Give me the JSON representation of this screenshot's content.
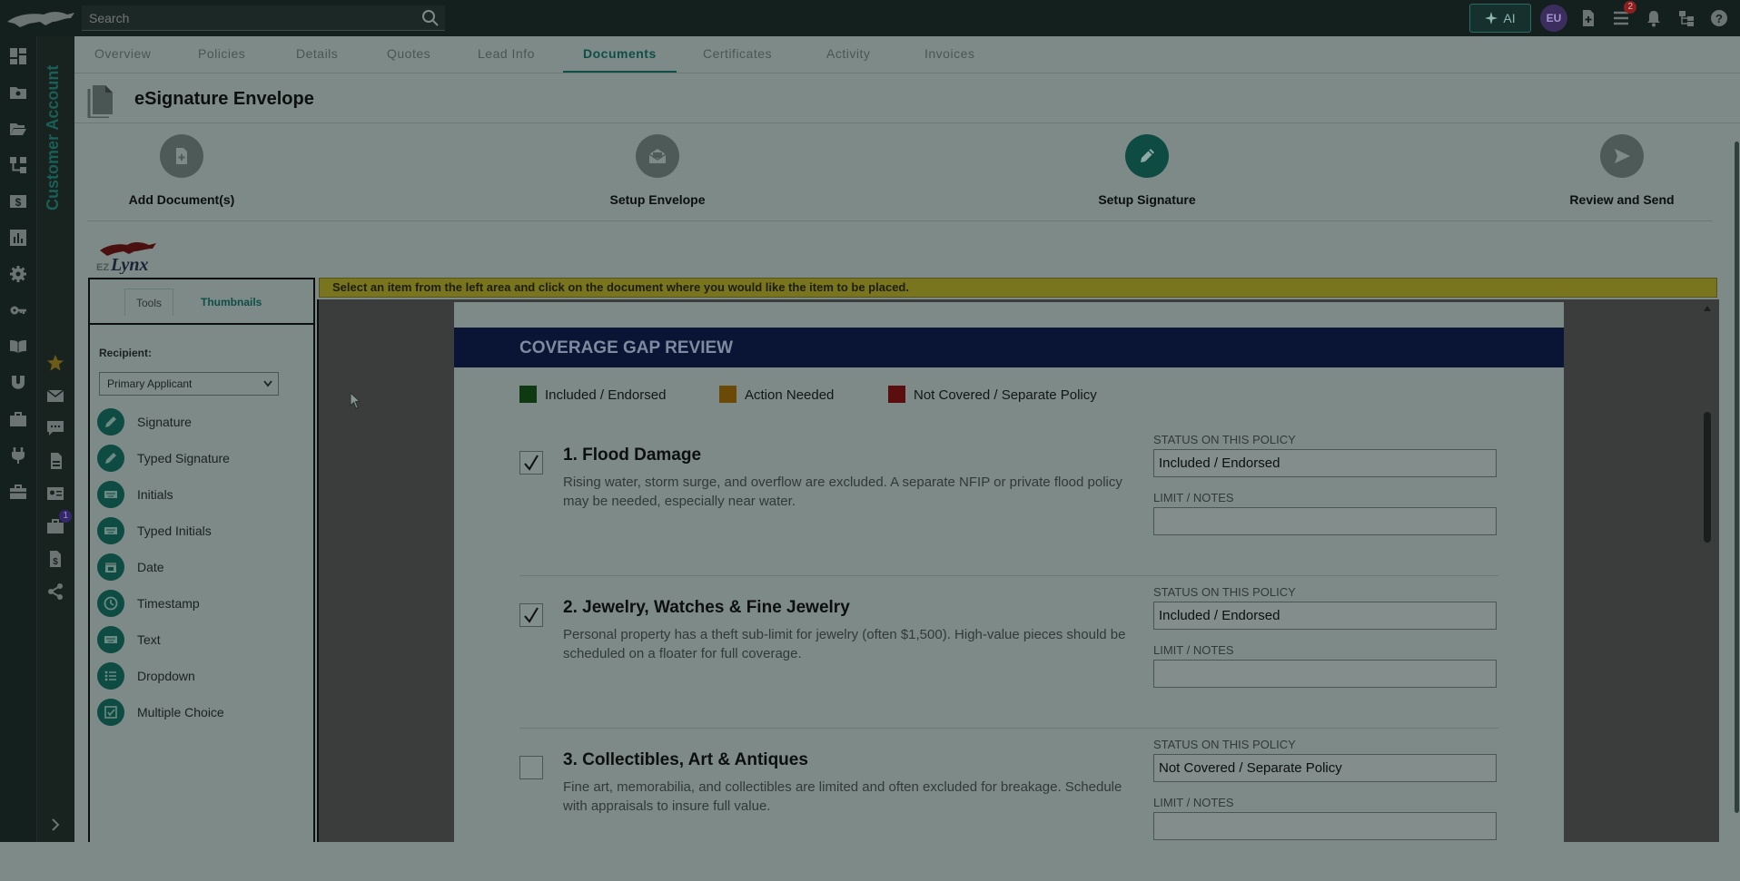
{
  "topbar": {
    "search_placeholder": "Search",
    "ai_label": "AI",
    "user_initials": "EU",
    "task_badge": "2"
  },
  "sidebar": {
    "title": "Customer Account",
    "tasks_badge": "1"
  },
  "tabs": [
    {
      "label": "Overview"
    },
    {
      "label": "Policies"
    },
    {
      "label": "Details"
    },
    {
      "label": "Quotes"
    },
    {
      "label": "Lead Info"
    },
    {
      "label": "Documents"
    },
    {
      "label": "Certificates"
    },
    {
      "label": "Activity"
    },
    {
      "label": "Invoices"
    }
  ],
  "page": {
    "title": "eSignature Envelope"
  },
  "steps": [
    {
      "label": "Add Document(s)"
    },
    {
      "label": "Setup Envelope"
    },
    {
      "label": "Setup Signature"
    },
    {
      "label": "Review and Send"
    }
  ],
  "tools_panel": {
    "tab_tools": "Tools",
    "tab_thumbnails": "Thumbnails",
    "recipient_label": "Recipient:",
    "recipient_value": "Primary Applicant",
    "items": [
      {
        "label": "Signature",
        "icon": "pen-icon"
      },
      {
        "label": "Typed Signature",
        "icon": "pen-icon"
      },
      {
        "label": "Initials",
        "icon": "keyboard-icon"
      },
      {
        "label": "Typed Initials",
        "icon": "keyboard-icon"
      },
      {
        "label": "Date",
        "icon": "calendar-icon"
      },
      {
        "label": "Timestamp",
        "icon": "clock-icon"
      },
      {
        "label": "Text",
        "icon": "keyboard-icon"
      },
      {
        "label": "Dropdown",
        "icon": "list-icon"
      },
      {
        "label": "Multiple Choice",
        "icon": "checkbox-icon"
      }
    ]
  },
  "instruction": "Select an item from the left area and click on the document where you would like the item to be placed.",
  "document": {
    "header": "COVERAGE GAP REVIEW",
    "legend": [
      {
        "label": "Included / Endorsed",
        "color": "#0e3a12"
      },
      {
        "label": "Action Needed",
        "color": "#6b4a08"
      },
      {
        "label": "Not Covered / Separate Policy",
        "color": "#5a0e0e"
      }
    ],
    "status_label": "STATUS ON THIS POLICY",
    "notes_label": "LIMIT / NOTES",
    "items": [
      {
        "title": "1. Flood Damage",
        "description": "Rising water, storm surge, and overflow are excluded. A separate NFIP or private flood policy may be needed, especially near water.",
        "status": "Included / Endorsed",
        "notes": "",
        "checked": true
      },
      {
        "title": "2. Jewelry, Watches & Fine Jewelry",
        "description": "Personal property has a theft sub-limit for jewelry (often $1,500). High-value pieces should be scheduled on a floater for full coverage.",
        "status": "Included / Endorsed",
        "notes": "",
        "checked": true
      },
      {
        "title": "3. Collectibles, Art & Antiques",
        "description": "Fine art, memorabilia, and collectibles are limited and often excluded for breakage. Schedule with appraisals to insure full value.",
        "status": "Not Covered / Separate Policy",
        "notes": "",
        "checked": false
      }
    ]
  }
}
